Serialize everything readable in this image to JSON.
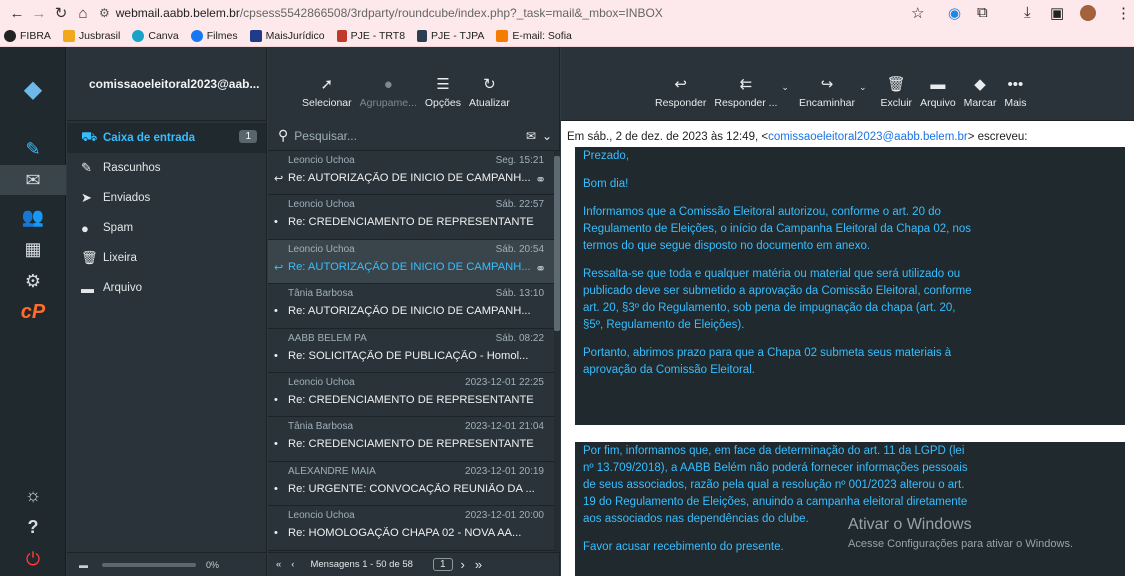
{
  "browser": {
    "url_prefix": "webmail.aabb.belem.br",
    "url_rest": "/cpsess5542866508/3rdparty/roundcube/index.php?_task=mail&_mbox=INBOX",
    "bookmarks": [
      "FIBRA",
      "Jusbrasil",
      "Canva",
      "Filmes",
      "MaisJurídico",
      "PJE - TRT8",
      "PJE - TJPA",
      "E-mail: Sofia"
    ]
  },
  "account": {
    "email": "comissaoeleitoral2023@aab..."
  },
  "list_toolbar": {
    "select": "Selecionar",
    "group": "Agrupame...",
    "options": "Opções",
    "refresh": "Atualizar"
  },
  "preview_toolbar": {
    "reply": "Responder",
    "reply_all": "Responder ...",
    "forward": "Encaminhar",
    "delete": "Excluir",
    "archive": "Arquivo",
    "mark": "Marcar",
    "more": "Mais"
  },
  "folders": [
    {
      "label": "Caixa de entrada",
      "count": "1"
    },
    {
      "label": "Rascunhos"
    },
    {
      "label": "Enviados"
    },
    {
      "label": "Spam"
    },
    {
      "label": "Lixeira"
    },
    {
      "label": "Arquivo"
    }
  ],
  "quota": "0%",
  "search": {
    "placeholder": "Pesquisar..."
  },
  "messages": [
    {
      "from": "Leoncio Uchoa",
      "date": "Seg. 15:21",
      "subject": "Re: AUTORIZAÇÃO DE INICIO DE CAMPANH...",
      "marker": "↩",
      "clip": true
    },
    {
      "from": "Leoncio Uchoa",
      "date": "Sáb. 22:57",
      "subject": "Re: CREDENCIAMENTO DE REPRESENTANTE",
      "marker": "•"
    },
    {
      "from": "Leoncio Uchoa",
      "date": "Sáb. 20:54",
      "subject": "Re: AUTORIZAÇÃO DE INICIO DE CAMPANH...",
      "marker": "↩",
      "clip": true,
      "selected": true
    },
    {
      "from": "Tânia Barbosa",
      "date": "Sáb. 13:10",
      "subject": "Re: AUTORIZAÇÃO DE INICIO DE CAMPANH...",
      "marker": "•"
    },
    {
      "from": "AABB BELEM PA",
      "date": "Sáb. 08:22",
      "subject": "Re: SOLICITAÇÃO DE PUBLICAÇÃO - Homol...",
      "marker": "•"
    },
    {
      "from": "Leoncio Uchoa",
      "date": "2023-12-01 22:25",
      "subject": "Re: CREDENCIAMENTO DE REPRESENTANTE",
      "marker": "•"
    },
    {
      "from": "Tânia Barbosa",
      "date": "2023-12-01 21:04",
      "subject": "Re: CREDENCIAMENTO DE REPRESENTANTE",
      "marker": "•"
    },
    {
      "from": "ALEXANDRE MAIA",
      "date": "2023-12-01 20:19",
      "subject": "Re: URGENTE: CONVOCAÇÃO REUNIÃO DA ...",
      "marker": "•"
    },
    {
      "from": "Leoncio Uchoa",
      "date": "2023-12-01 20:00",
      "subject": "Re: HOMOLOGAÇÃO CHAPA 02 - NOVA AA...",
      "marker": "•"
    }
  ],
  "pagination": {
    "label": "Mensagens 1 - 50 de 58",
    "page": "1"
  },
  "email": {
    "intro_before": "Em sáb., 2 de dez. de 2023 às 12:49, <",
    "intro_link": "comissaoeleitoral2023@aabb.belem.br",
    "intro_after": "> escreveu:",
    "block1": [
      "Prezado,",
      "Bom dia!",
      "Informamos que a Comissão Eleitoral autorizou, conforme o art. 20 do Regulamento de Eleições, o início da Campanha Eleitoral da Chapa 02, nos termos do que segue disposto no documento em anexo.",
      "Ressalta-se que toda e qualquer matéria ou material que será utilizado ou publicado deve ser submetido a aprovação da Comissão Eleitoral, conforme art. 20, §3º do Regulamento,  sob pena de impugnação da chapa (art. 20, §5º, Regulamento de Eleições).",
      "Portanto, abrimos prazo para que a Chapa 02 submeta seus materiais à aprovação da Comissão Eleitoral."
    ],
    "block2": [
      "Por fim, informamos que, em face da determinação do art. 11 da LGPD (lei nº 13.709/2018), a AABB Belém não poderá fornecer informações pessoais de seus associados, razão pela qual a resolução nº 001/2023 alterou o art. 19 do Regulamento de Eleições, anuindo a campanha eleitoral diretamente aos associados nas dependências do clube.",
      "Favor acusar recebimento do presente."
    ]
  },
  "watermark": {
    "line1": "Ativar o Windows",
    "line2": "Acesse Configurações para ativar o Windows."
  }
}
